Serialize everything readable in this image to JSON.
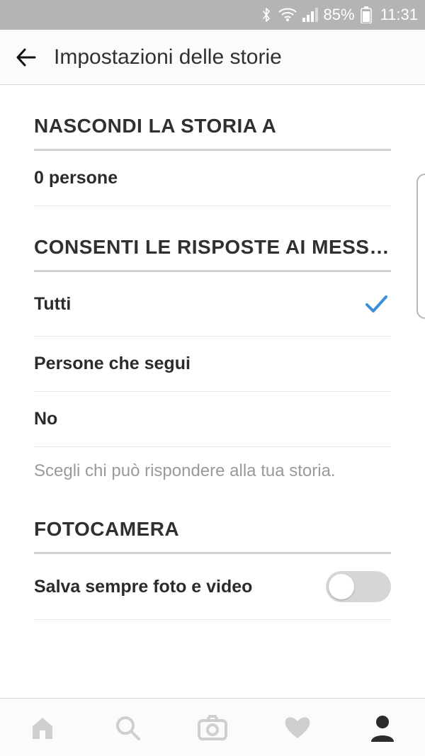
{
  "statusbar": {
    "battery_percent": "85%",
    "clock": "11:31"
  },
  "header": {
    "title": "Impostazioni delle storie"
  },
  "sections": {
    "hide": {
      "title": "NASCONDI LA STORIA A",
      "people_row": "0 persone"
    },
    "replies": {
      "title": "CONSENTI LE RISPOSTE AI MESSA…",
      "opt_all": "Tutti",
      "opt_following": "Persone che segui",
      "opt_off": "No",
      "helper": "Scegli chi può rispondere alla tua storia."
    },
    "camera": {
      "title": "FOTOCAMERA",
      "save_label": "Salva sempre foto e video"
    }
  }
}
